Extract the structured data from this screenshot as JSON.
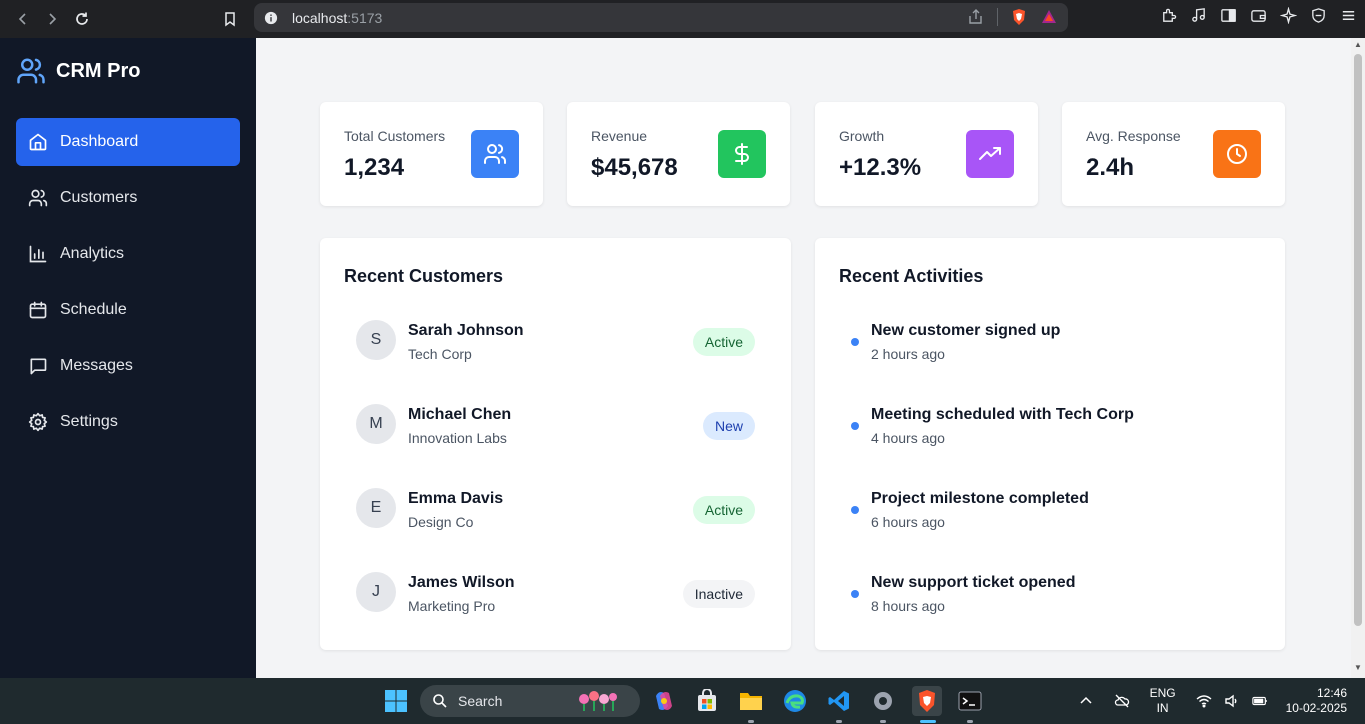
{
  "browser": {
    "url_host": "localhost",
    "url_port": ":5173"
  },
  "sidebar": {
    "brand": "CRM Pro",
    "items": [
      {
        "label": "Dashboard",
        "icon": "home-icon",
        "active": true
      },
      {
        "label": "Customers",
        "icon": "users-icon"
      },
      {
        "label": "Analytics",
        "icon": "bar-chart-icon"
      },
      {
        "label": "Schedule",
        "icon": "calendar-icon"
      },
      {
        "label": "Messages",
        "icon": "message-icon"
      },
      {
        "label": "Settings",
        "icon": "gear-icon"
      }
    ]
  },
  "stats": [
    {
      "label": "Total Customers",
      "value": "1,234",
      "icon": "users-icon",
      "color": "#3b82f6"
    },
    {
      "label": "Revenue",
      "value": "$45,678",
      "icon": "dollar-icon",
      "color": "#22c55e"
    },
    {
      "label": "Growth",
      "value": "+12.3%",
      "icon": "trending-up-icon",
      "color": "#a855f7"
    },
    {
      "label": "Avg. Response",
      "value": "2.4h",
      "icon": "clock-icon",
      "color": "#f97316"
    }
  ],
  "recent_customers": {
    "title": "Recent Customers",
    "items": [
      {
        "initial": "S",
        "name": "Sarah Johnson",
        "company": "Tech Corp",
        "status": "Active"
      },
      {
        "initial": "M",
        "name": "Michael Chen",
        "company": "Innovation Labs",
        "status": "New"
      },
      {
        "initial": "E",
        "name": "Emma Davis",
        "company": "Design Co",
        "status": "Active"
      },
      {
        "initial": "J",
        "name": "James Wilson",
        "company": "Marketing Pro",
        "status": "Inactive"
      }
    ]
  },
  "recent_activities": {
    "title": "Recent Activities",
    "items": [
      {
        "title": "New customer signed up",
        "time": "2 hours ago"
      },
      {
        "title": "Meeting scheduled with Tech Corp",
        "time": "4 hours ago"
      },
      {
        "title": "Project milestone completed",
        "time": "6 hours ago"
      },
      {
        "title": "New support ticket opened",
        "time": "8 hours ago"
      }
    ]
  },
  "badge_colors": {
    "Active": {
      "bg": "#dcfce7",
      "fg": "#166534"
    },
    "New": {
      "bg": "#dbeafe",
      "fg": "#1e40af"
    },
    "Inactive": {
      "bg": "#f3f4f6",
      "fg": "#1f2937"
    }
  },
  "taskbar": {
    "search_label": "Search",
    "lang_top": "ENG",
    "lang_bottom": "IN",
    "time": "12:46",
    "date": "10-02-2025"
  }
}
